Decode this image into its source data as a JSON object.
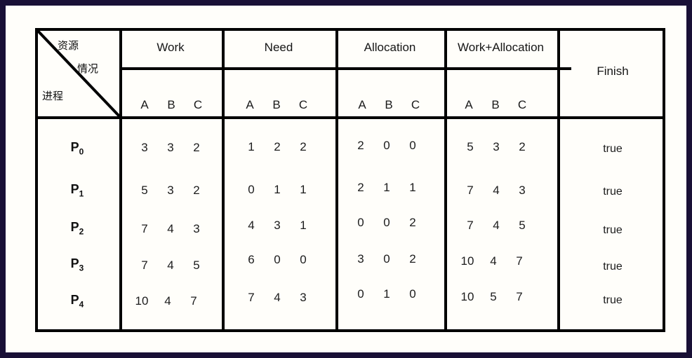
{
  "frame": {
    "border_color": "#191036",
    "background": "#fffefa"
  },
  "table": {
    "corner": {
      "resource_label": "资源",
      "situation_label": "情况",
      "process_label": "进程"
    },
    "group_headers": [
      {
        "label": "Work"
      },
      {
        "label": "Need"
      },
      {
        "label": "Allocation"
      },
      {
        "label": "Work+Allocation"
      }
    ],
    "sub_headers": [
      "A",
      "B",
      "C"
    ],
    "finish_header": "Finish",
    "rows": [
      {
        "process": "P",
        "process_index": "0",
        "work": [
          "3",
          "3",
          "2"
        ],
        "need": [
          "1",
          "2",
          "2"
        ],
        "allocation": [
          "2",
          "0",
          "0"
        ],
        "work_plus_allocation": [
          "5",
          "3",
          "2"
        ],
        "finish": "true"
      },
      {
        "process": "P",
        "process_index": "1",
        "work": [
          "5",
          "3",
          "2"
        ],
        "need": [
          "0",
          "1",
          "1"
        ],
        "allocation": [
          "2",
          "1",
          "1"
        ],
        "work_plus_allocation": [
          "7",
          "4",
          "3"
        ],
        "finish": "true"
      },
      {
        "process": "P",
        "process_index": "2",
        "work": [
          "7",
          "4",
          "3"
        ],
        "need": [
          "4",
          "3",
          "1"
        ],
        "allocation": [
          "0",
          "0",
          "2"
        ],
        "work_plus_allocation": [
          "7",
          "4",
          "5"
        ],
        "finish": "true"
      },
      {
        "process": "P",
        "process_index": "3",
        "work": [
          "7",
          "4",
          "5"
        ],
        "need": [
          "6",
          "0",
          "0"
        ],
        "allocation": [
          "3",
          "0",
          "2"
        ],
        "work_plus_allocation": [
          "10",
          "4",
          "7"
        ],
        "finish": "true"
      },
      {
        "process": "P",
        "process_index": "4",
        "work": [
          "10",
          "4",
          "7"
        ],
        "need": [
          "7",
          "4",
          "3"
        ],
        "allocation": [
          "0",
          "1",
          "0"
        ],
        "work_plus_allocation": [
          "10",
          "5",
          "7"
        ],
        "finish": "true"
      }
    ]
  }
}
